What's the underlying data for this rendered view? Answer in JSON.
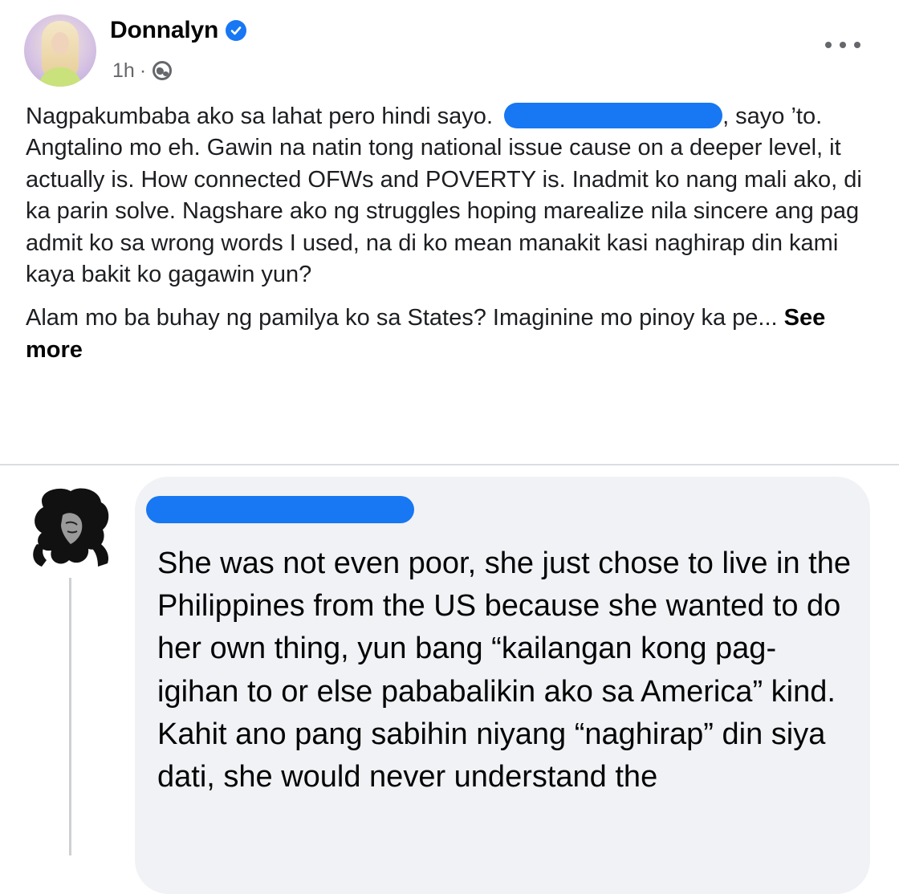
{
  "post": {
    "author_name": "Donnalyn",
    "timestamp": "1h",
    "separator": "·",
    "icons": {
      "verified": "verified-badge-icon",
      "audience": "globe-icon",
      "more": "more-options-icon"
    },
    "colors": {
      "verified": "#1877f2",
      "redaction": "#1877f2"
    },
    "paragraph_1": {
      "part_1": "Nagpakumbaba ako sa lahat pero hindi sayo. ",
      "part_2": ", sayo ’to. Angtalino mo eh. Gawin na natin tong national issue cause on a deeper level, it actually is. How connected OFWs and POVERTY is. Inadmit ko nang mali ako, di ka parin solve. Nagshare ako ng struggles hoping marealize nila sincere ang pag admit ko sa wrong words I used, na di ko mean manakit kasi naghirap din kami kaya bakit ko gagawin yun?"
    },
    "paragraph_2": "Alam mo ba buhay ng pamilya ko sa States? Imaginine mo pinoy ka pe... ",
    "see_more": "See more"
  },
  "comment": {
    "text": "She was not even poor, she just chose to live in the Philippines from the US because she wanted to do her own thing, yun bang “kailangan kong pag-igihan to or else pababalikin ako sa America” kind. Kahit ano pang sabihin niyang “naghirap” din siya dati, she would never understand the",
    "colors": {
      "bubble": "#f0f2f5",
      "redaction": "#1877f2"
    }
  }
}
